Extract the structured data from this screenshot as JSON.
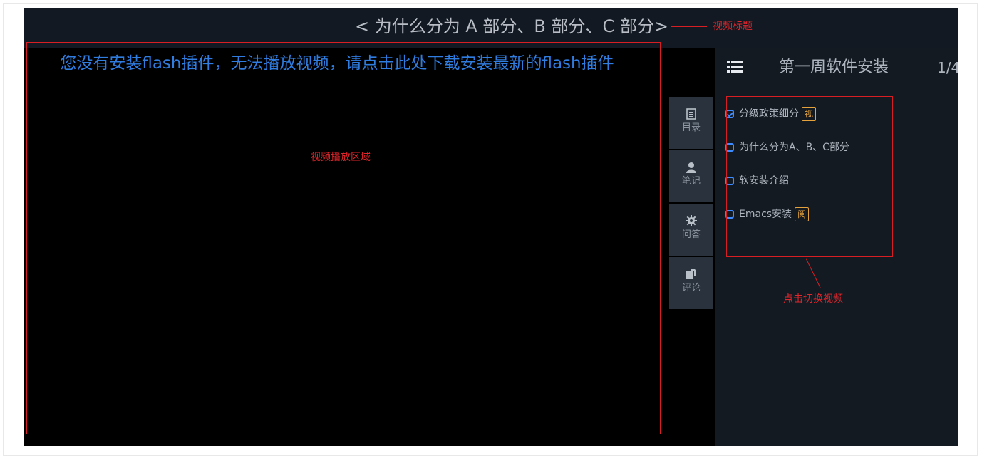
{
  "header": {
    "video_title": "< 为什么分为 A 部分、B 部分、C 部分>"
  },
  "player": {
    "flash_message": "您没有安装flash插件，无法播放视频，请点击此处下载安装最新的flash插件"
  },
  "side_tabs": [
    {
      "icon": "catalog-icon",
      "label": "目录"
    },
    {
      "icon": "user-icon",
      "label": "笔记"
    },
    {
      "icon": "gear-icon",
      "label": "问答"
    },
    {
      "icon": "comment-icon",
      "label": "评论"
    }
  ],
  "chapter": {
    "icon": "list-icon",
    "title": "第一周软件安装",
    "page": "1/4"
  },
  "lessons": [
    {
      "title": "分级政策细分",
      "badge": "视",
      "checked": true
    },
    {
      "title": "为什么分为A、B、C部分",
      "badge": "",
      "checked": false
    },
    {
      "title": "软安装介绍",
      "badge": "",
      "checked": false
    },
    {
      "title": "Emacs安装",
      "badge": "阅",
      "checked": false
    }
  ],
  "annotations": {
    "title_note": "视频标题",
    "player_note": "视频播放区域",
    "list_note": "点击切换视频"
  },
  "colors": {
    "app_bg": "#141a22",
    "player_bg": "#000000",
    "flash_text": "#2f7de1",
    "annotation_red": "#d81e23",
    "badge_orange": "#e5a23c",
    "check_blue": "#3d8bff"
  }
}
